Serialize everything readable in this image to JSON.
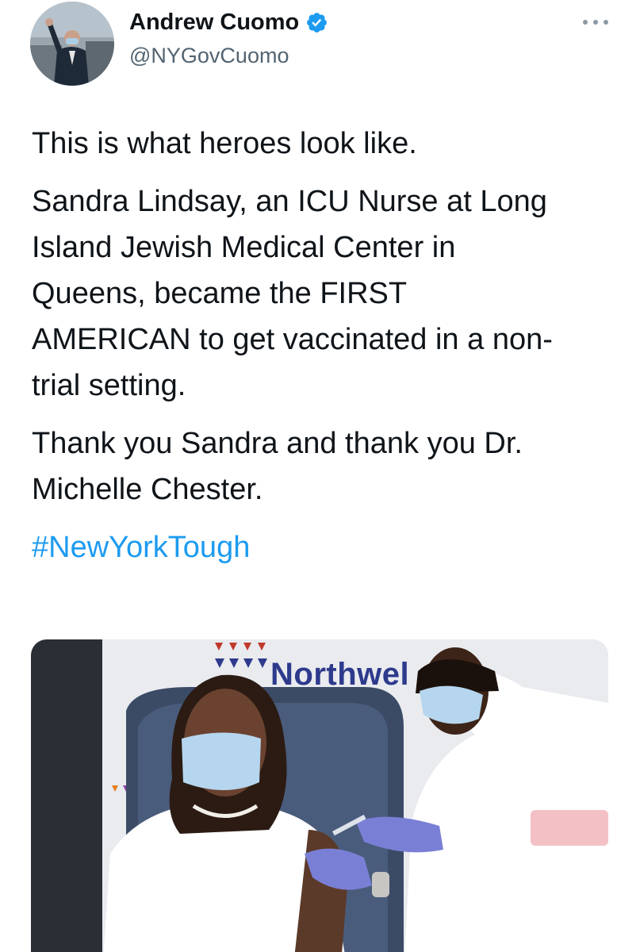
{
  "author": {
    "display_name": "Andrew Cuomo",
    "handle": "@NYGovCuomo",
    "verified": true,
    "avatar_icon": "person-waving-avatar"
  },
  "tweet": {
    "paragraphs": [
      "This is what heroes look like.",
      "Sandra Lindsay, an ICU Nurse at Long\nIsland Jewish Medical Center in\nQueens, became the FIRST\nAMERICAN to get vaccinated in a non-\ntrial setting.",
      "Thank you Sandra and thank you Dr.\nMichelle Chester."
    ],
    "hashtag": "#NewYorkTough"
  },
  "media": {
    "sign_text": "Northwel"
  },
  "colors": {
    "accent": "#1d9bf0",
    "verified_badge": "#1d9bf0",
    "handle_gray": "#536471"
  },
  "icons": {
    "more": "more-dots-icon",
    "verified": "verified-badge-icon"
  }
}
